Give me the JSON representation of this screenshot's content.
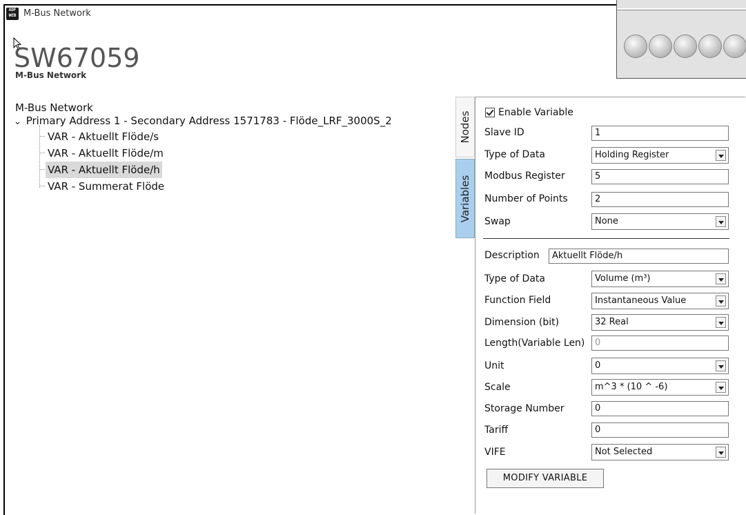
{
  "window": {
    "title": "M-Bus Network"
  },
  "header": {
    "product_code": "SW67059",
    "product_subtitle": "M-Bus Network"
  },
  "tree": {
    "root": "M-Bus Network",
    "node": "Primary Address 1 - Secondary Address 1571783 - Flöde_LRF_3000S_2",
    "items": [
      {
        "label": "VAR - Aktuellt Flöde/s",
        "selected": false
      },
      {
        "label": "VAR - Aktuellt Flöde/m",
        "selected": false
      },
      {
        "label": "VAR - Aktuellt Flöde/h",
        "selected": true
      },
      {
        "label": "VAR - Summerat Flöde",
        "selected": false
      }
    ]
  },
  "tabs": {
    "nodes": "Nodes",
    "variables": "Variables"
  },
  "form": {
    "enable_variable": {
      "label": "Enable Variable",
      "checked": true
    },
    "slave_id": {
      "label": "Slave ID",
      "value": "1"
    },
    "type_of_data_modbus": {
      "label": "Type of Data",
      "value": "Holding Register"
    },
    "modbus_register": {
      "label": "Modbus Register",
      "value": "5"
    },
    "number_of_points": {
      "label": "Number of Points",
      "value": "2"
    },
    "swap": {
      "label": "Swap",
      "value": "None"
    },
    "description": {
      "label": "Description",
      "value": "Aktuellt Flöde/h"
    },
    "type_of_data_mbus": {
      "label": "Type of Data",
      "value": "Volume (m³)"
    },
    "function_field": {
      "label": "Function Field",
      "value": "Instantaneous Value"
    },
    "dimension": {
      "label": "Dimension (bit)",
      "value": "32 Real"
    },
    "length": {
      "label": "Length(Variable Len)",
      "placeholder": "0"
    },
    "unit": {
      "label": "Unit",
      "value": "0"
    },
    "scale": {
      "label": "Scale",
      "value": "m^3 * (10 ^ -6)"
    },
    "storage_number": {
      "label": "Storage Number",
      "value": "0"
    },
    "tariff": {
      "label": "Tariff",
      "value": "0"
    },
    "vife": {
      "label": "VIFE",
      "value": "Not Selected"
    },
    "modify_button": "MODIFY VARIABLE"
  }
}
